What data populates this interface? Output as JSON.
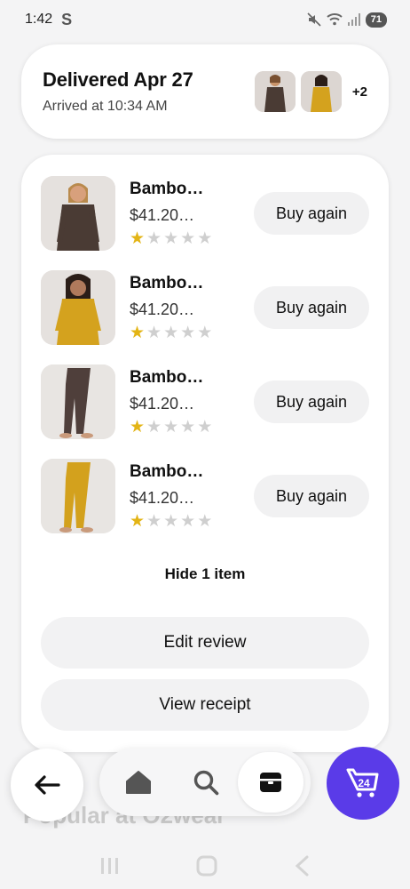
{
  "status_bar": {
    "time": "1:42",
    "app_letter": "S",
    "battery": "71"
  },
  "delivery": {
    "title": "Delivered Apr 27",
    "subtitle": "Arrived at 10:34 AM",
    "more_count": "+2"
  },
  "items": [
    {
      "name": "Bambo…",
      "price": "$41.20…",
      "rating": 1,
      "button": "Buy again",
      "color": "#4a3b34"
    },
    {
      "name": "Bambo…",
      "price": "$41.20…",
      "rating": 1,
      "button": "Buy again",
      "color": "#d4a21e"
    },
    {
      "name": "Bambo…",
      "price": "$41.20…",
      "rating": 1,
      "button": "Buy again",
      "color": "#4f3f3b"
    },
    {
      "name": "Bambo…",
      "price": "$41.20…",
      "rating": 1,
      "button": "Buy again",
      "color": "#d3a11d"
    }
  ],
  "hide_link": "Hide 1 item",
  "edit_review": "Edit review",
  "view_receipt": "View receipt",
  "background_text": "Popular at O2wear",
  "cart": {
    "count": "24",
    "color": "#5a3be8"
  },
  "icons": {
    "back": "arrow-left-icon",
    "home": "home-icon",
    "search": "search-icon",
    "orders": "box-icon",
    "cart": "cart-icon"
  }
}
